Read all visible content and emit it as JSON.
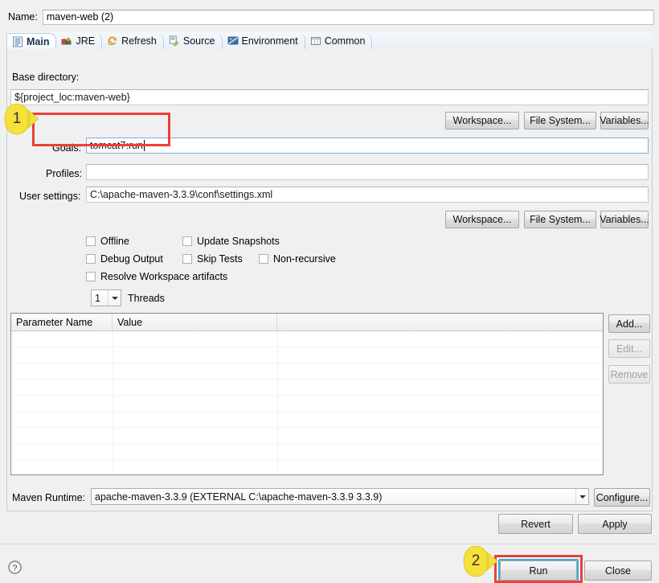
{
  "dialog": {
    "name_label": "Name:",
    "name_value": "maven-web (2)"
  },
  "tabs": [
    {
      "label": "Main",
      "icon": "main-tab-icon",
      "active": true
    },
    {
      "label": "JRE",
      "icon": "jre-tab-icon",
      "active": false
    },
    {
      "label": "Refresh",
      "icon": "refresh-tab-icon",
      "active": false
    },
    {
      "label": "Source",
      "icon": "source-tab-icon",
      "active": false
    },
    {
      "label": "Environment",
      "icon": "environment-tab-icon",
      "active": false
    },
    {
      "label": "Common",
      "icon": "common-tab-icon",
      "active": false
    }
  ],
  "main": {
    "base_directory_label": "Base directory:",
    "base_directory_value": "${project_loc:maven-web}",
    "browse_row_1": {
      "workspace": "Workspace...",
      "file_system": "File System...",
      "variables": "Variables..."
    },
    "goals_label": "Goals:",
    "goals_value": "tomcat7:run",
    "profiles_label": "Profiles:",
    "profiles_value": "",
    "user_settings_label": "User settings:",
    "user_settings_value": "C:\\apache-maven-3.3.9\\conf\\settings.xml",
    "browse_row_2": {
      "workspace": "Workspace...",
      "file_system": "File System...",
      "variables": "Variables..."
    },
    "checkboxes": [
      {
        "label": "Offline",
        "checked": false
      },
      {
        "label": "Update Snapshots",
        "checked": false
      },
      {
        "label": "Debug Output",
        "checked": false
      },
      {
        "label": "Skip Tests",
        "checked": false
      },
      {
        "label": "Non-recursive",
        "checked": false
      },
      {
        "label": "Resolve Workspace artifacts",
        "checked": false
      }
    ],
    "threads": {
      "value": "1",
      "label": "Threads"
    },
    "parameter_table": {
      "columns": [
        "Parameter Name",
        "Value"
      ],
      "rows": []
    },
    "table_buttons": {
      "add": "Add...",
      "edit": "Edit...",
      "remove": "Remove"
    },
    "maven_runtime_label": "Maven Runtime:",
    "maven_runtime_value": "apache-maven-3.3.9 (EXTERNAL C:\\apache-maven-3.3.9 3.3.9)",
    "configure_button": "Configure..."
  },
  "footer": {
    "revert": "Revert",
    "apply": "Apply",
    "run": "Run",
    "close": "Close",
    "help_icon": "help-icon"
  },
  "annotations": [
    {
      "number": "1",
      "target": "goals-field"
    },
    {
      "number": "2",
      "target": "run-button"
    }
  ],
  "colors": {
    "annotation_red": "#e8413a",
    "annotation_yellow": "#f5e03c",
    "focus_blue": "#3ea9e0",
    "dialog_bg": "#f0f0f0"
  }
}
